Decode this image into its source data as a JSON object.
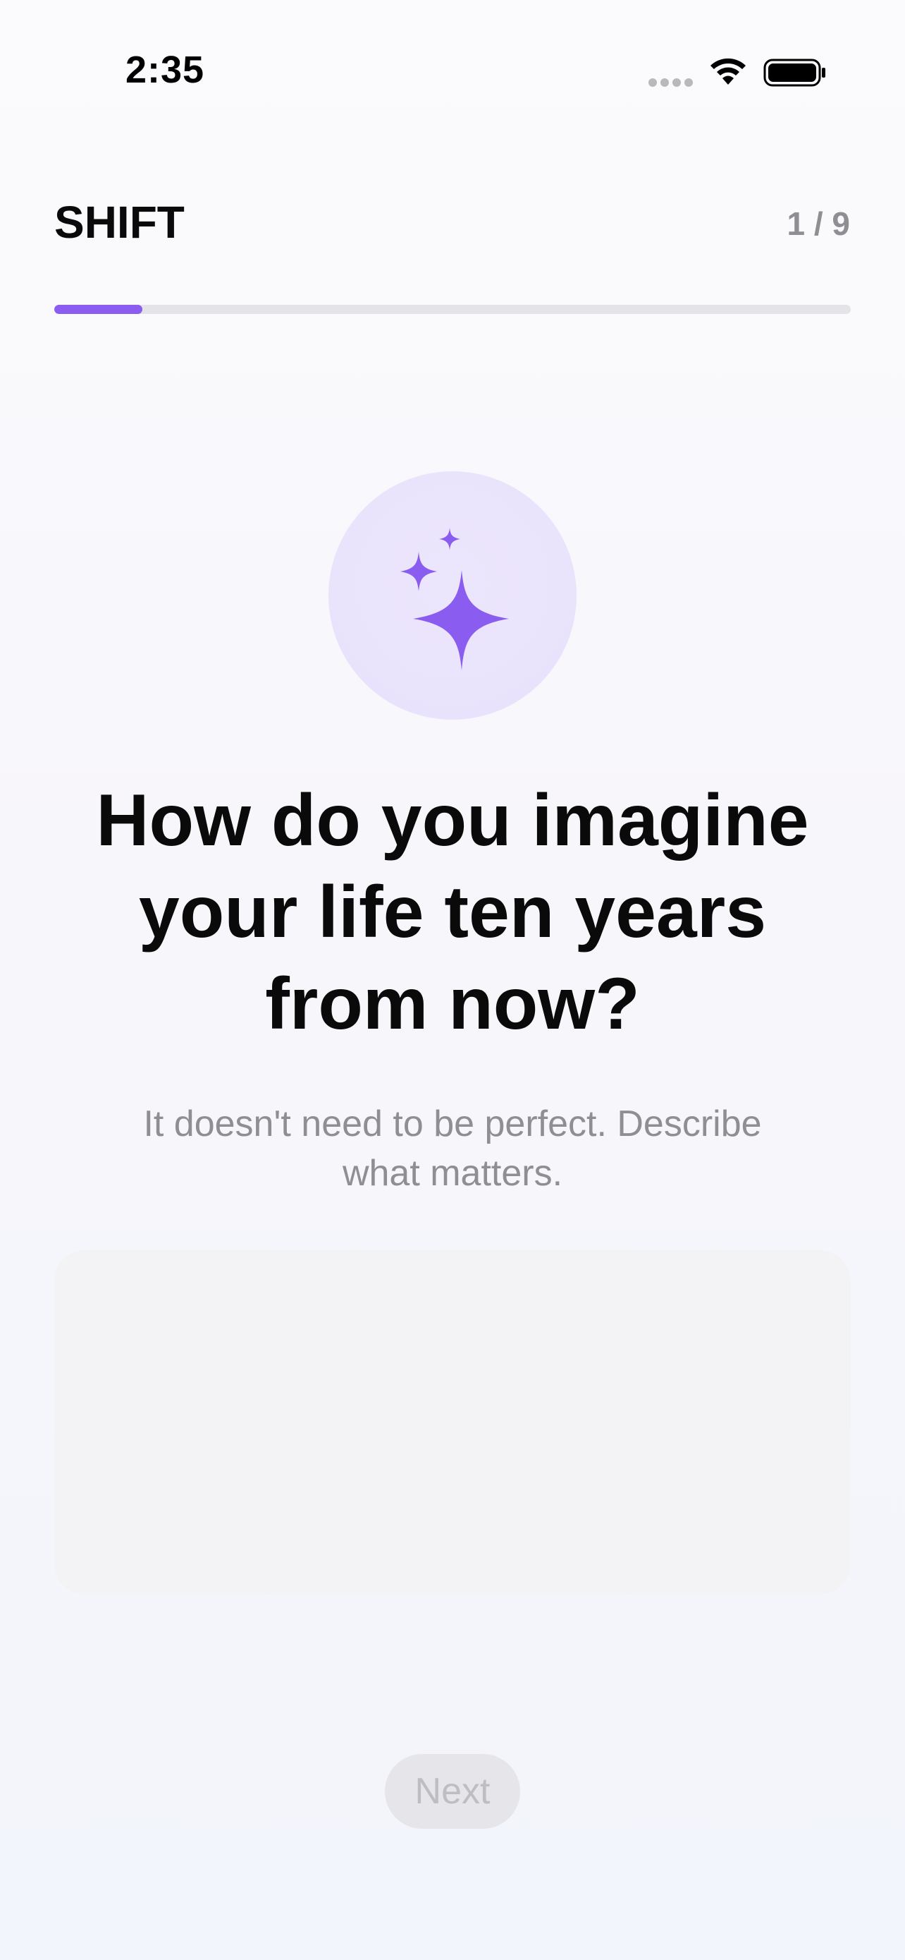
{
  "status_bar": {
    "time": "2:35",
    "icons": [
      "signal-dots-icon",
      "wifi-icon",
      "battery-icon"
    ]
  },
  "header": {
    "brand": "SHIFT",
    "step_counter": "1 / 9",
    "progress_fraction": 0.111
  },
  "hero": {
    "icon": "sparkles-icon",
    "question": "How do you imagine your life ten years from now?",
    "subtitle": "It doesn't need to be perfect. Describe what matters."
  },
  "answer": {
    "value": "",
    "placeholder": ""
  },
  "footer": {
    "next_label": "Next",
    "next_enabled": false
  },
  "colors": {
    "accent": "#8a5cf0",
    "icon_circle": "#ebe4fc",
    "secondary_text": "#8e8e93",
    "disabled_button_bg": "#e6e6ea",
    "disabled_button_text": "#bdbdc2"
  }
}
